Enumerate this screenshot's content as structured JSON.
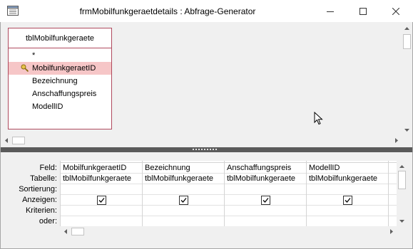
{
  "window": {
    "title": "frmMobilfunkgeraetdetails : Abfrage-Generator",
    "controls": [
      "minimize-icon",
      "maximize-icon",
      "close-icon"
    ]
  },
  "table_box": {
    "name": "tblMobilfunkgeraete",
    "fields": [
      {
        "label": "*",
        "primary_key": false
      },
      {
        "label": "MobilfunkgeraetID",
        "primary_key": true
      },
      {
        "label": "Bezeichnung",
        "primary_key": false
      },
      {
        "label": "Anschaffungspreis",
        "primary_key": false
      },
      {
        "label": "ModellID",
        "primary_key": false
      }
    ],
    "key_color": "#f6c6c7",
    "border_color": "#b04a5e"
  },
  "grid": {
    "row_labels": [
      "Feld:",
      "Tabelle:",
      "Sortierung:",
      "Anzeigen:",
      "Kriterien:",
      "oder:"
    ],
    "columns": [
      {
        "feld": "MobilfunkgeraetID",
        "tabelle": "tblMobilfunkgeraete",
        "sortierung": "",
        "anzeigen": true,
        "kriterien": "",
        "oder": ""
      },
      {
        "feld": "Bezeichnung",
        "tabelle": "tblMobilfunkgeraete",
        "sortierung": "",
        "anzeigen": true,
        "kriterien": "",
        "oder": ""
      },
      {
        "feld": "Anschaffungspreis",
        "tabelle": "tblMobilfunkgeraete",
        "sortierung": "",
        "anzeigen": true,
        "kriterien": "",
        "oder": ""
      },
      {
        "feld": "ModellID",
        "tabelle": "tblMobilfunkgeraete",
        "sortierung": "",
        "anzeigen": true,
        "kriterien": "",
        "oder": ""
      }
    ]
  }
}
